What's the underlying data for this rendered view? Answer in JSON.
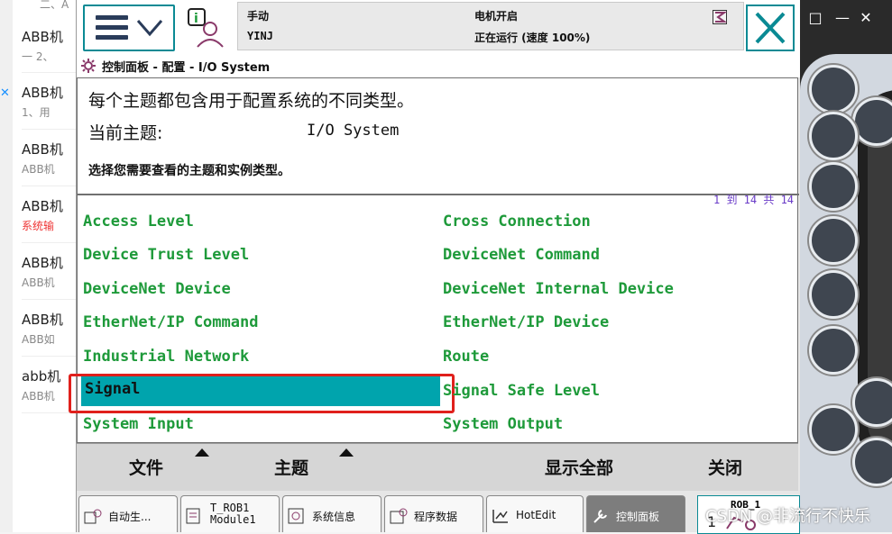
{
  "bg_page": {
    "rows": [
      {
        "title": "ABB机",
        "sub": "一 2、"
      },
      {
        "title": "ABB机",
        "sub": "1、用"
      },
      {
        "title": "ABB机",
        "sub": "ABB机"
      },
      {
        "title": "ABB机",
        "sub": "系统输"
      },
      {
        "title": "ABB机",
        "sub": "ABB机"
      },
      {
        "title": "ABB机",
        "sub": "ABB如"
      },
      {
        "title": "abb机",
        "sub": "ABB机"
      }
    ],
    "top_text": "二、A"
  },
  "status": {
    "mode": "手动",
    "station": "YINJ",
    "motor": "电机开启",
    "run_state": "正在运行 (速度 100%)"
  },
  "window_title": "控制面板 - 配置 - I/O System",
  "content": {
    "desc1": "每个主题都包含用于配置系统的不同类型。",
    "current_topic_label": "当前主题:",
    "current_topic_value": "I/O System",
    "instruction": "选择您需要查看的主题和实例类型。",
    "pager": "1 到 14 共 14"
  },
  "topics": [
    "Access Level",
    "Cross Connection",
    "Device Trust Level",
    "DeviceNet Command",
    "DeviceNet Device",
    "DeviceNet Internal Device",
    "EtherNet/IP Command",
    "EtherNet/IP Device",
    "Industrial Network",
    "Route",
    "Signal",
    "Signal Safe Level",
    "System Input",
    "System Output"
  ],
  "selected_topic": "Signal",
  "bottom_bar": {
    "file": "文件",
    "topic": "主题",
    "show_all": "显示全部",
    "close": "关闭"
  },
  "taskbar": [
    {
      "label": "自动生...",
      "icon": "auto-icon"
    },
    {
      "label": "T_ROB1\nModule1",
      "icon": "module-icon"
    },
    {
      "label": "系统信息",
      "icon": "system-info-icon"
    },
    {
      "label": "程序数据",
      "icon": "program-data-icon"
    },
    {
      "label": "HotEdit",
      "icon": "hotedit-icon"
    },
    {
      "label": "控制面板",
      "icon": "wrench-icon"
    }
  ],
  "rob_label": "ROB_1",
  "watermark": "CSDN @非流行不快乐",
  "colors": {
    "accent": "#0a8a94",
    "topic_text": "#1e9a3a",
    "selection": "#00a4ad",
    "highlight": "#e0201c"
  }
}
